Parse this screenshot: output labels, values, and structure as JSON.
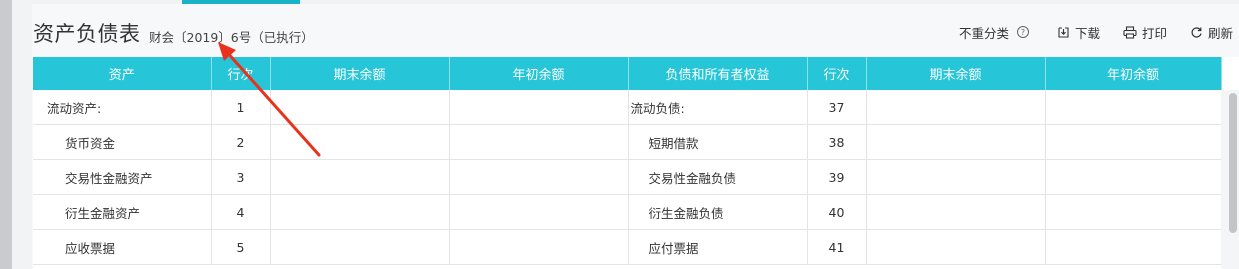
{
  "header": {
    "title": "资产负债表",
    "subtitle": "财会〔2019〕6号（已执行）"
  },
  "toolbar": {
    "no_classify_label": "不重分类",
    "download_label": "下载",
    "print_label": "打印",
    "refresh_label": "刷新"
  },
  "table": {
    "columns": [
      "资产",
      "行次",
      "期末余额",
      "年初余额",
      "负债和所有者权益",
      "行次",
      "期末余额",
      "年初余额"
    ],
    "rows": [
      {
        "asset": "流动资产:",
        "asset_line": "1",
        "liab": "流动负债:",
        "liab_line": "37"
      },
      {
        "asset": "货币资金",
        "asset_line": "2",
        "liab": "短期借款",
        "liab_line": "38"
      },
      {
        "asset": "交易性金融资产",
        "asset_line": "3",
        "liab": "交易性金融负债",
        "liab_line": "39"
      },
      {
        "asset": "衍生金融资产",
        "asset_line": "4",
        "liab": "衍生金融负债",
        "liab_line": "40"
      },
      {
        "asset": "应收票据",
        "asset_line": "5",
        "liab": "应付票据",
        "liab_line": "41"
      }
    ]
  },
  "colors": {
    "header_bg": "#26c6d8",
    "accent": "#17b2c8",
    "annotation_arrow": "#e8321e"
  },
  "icons": [
    "help-icon",
    "download-icon",
    "print-icon",
    "refresh-icon"
  ]
}
